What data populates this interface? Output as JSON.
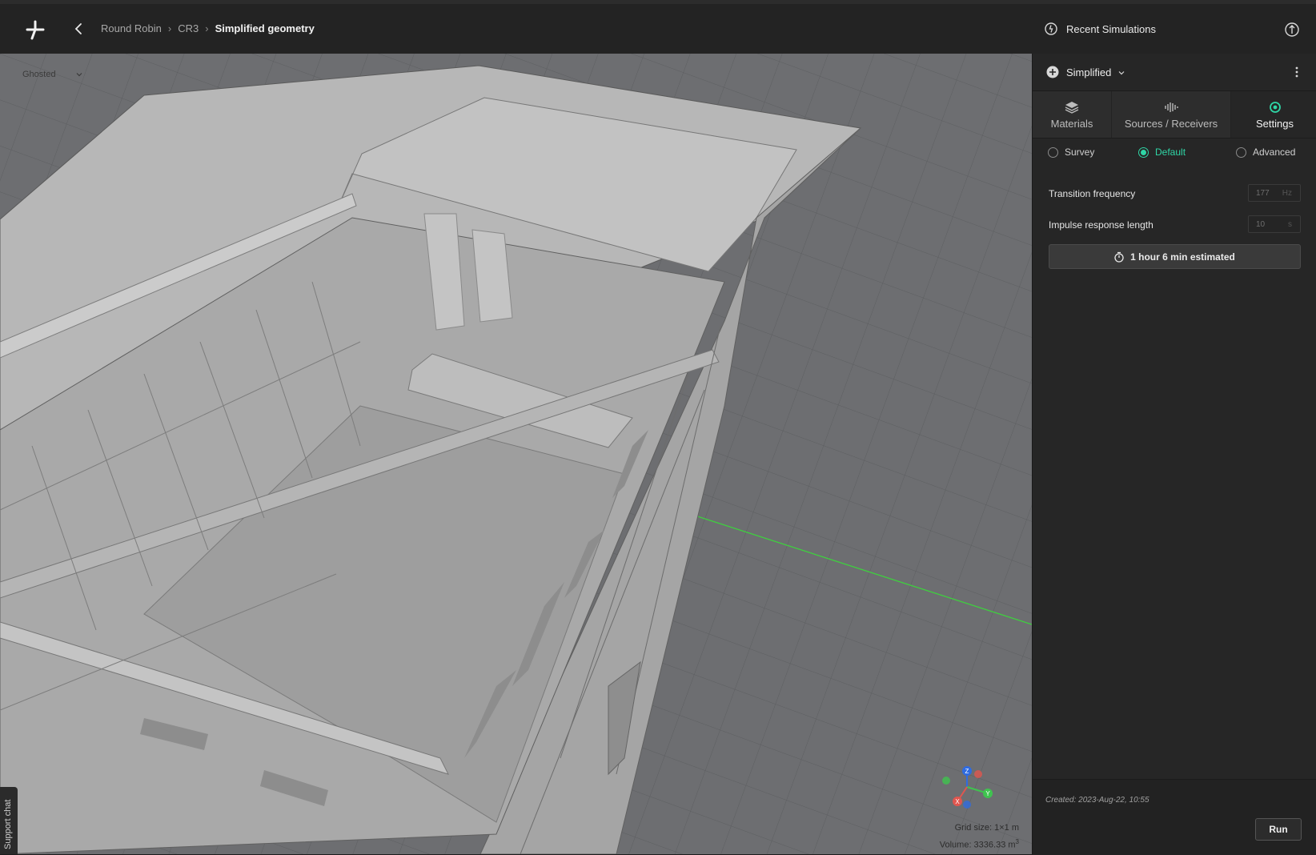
{
  "breadcrumb": {
    "project": "Round Robin",
    "model": "CR3",
    "current": "Simplified geometry"
  },
  "header": {
    "recent_label": "Recent Simulations"
  },
  "viewport": {
    "render_mode": "Ghosted",
    "grid_size": "Grid size: 1×1 m",
    "volume_prefix": "Volume: 3336.33 m",
    "volume_sup": "3",
    "axis_labels": {
      "x": "X",
      "y": "Y",
      "z": "Z"
    }
  },
  "support": {
    "label": "Support chat"
  },
  "simulation": {
    "name": "Simplified",
    "tabs": [
      {
        "label": "Materials",
        "icon": "layers-icon"
      },
      {
        "label": "Sources / Receivers",
        "icon": "waveform-icon"
      },
      {
        "label": "Settings",
        "icon": "settings-icon"
      }
    ],
    "active_tab": "Settings",
    "modes": [
      "Survey",
      "Default",
      "Advanced"
    ],
    "selected_mode": "Default",
    "transition_frequency": {
      "label": "Transition frequency",
      "value": "177",
      "unit": "Hz"
    },
    "impulse_response": {
      "label": "Impulse response length",
      "value": "10",
      "unit": "s"
    },
    "estimate": "1 hour 6 min estimated",
    "created": "Created: 2023-Aug-22, 10:55",
    "run_label": "Run"
  },
  "colors": {
    "accent": "#2fd6a6",
    "axis_x": "#e0564f",
    "axis_y": "#3fc34f",
    "axis_z": "#2f6be0"
  }
}
